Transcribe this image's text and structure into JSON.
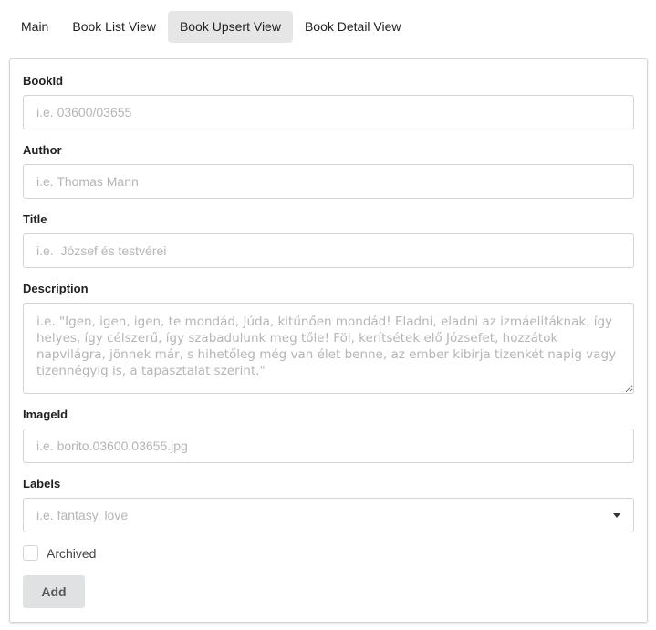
{
  "tabs": [
    {
      "label": "Main"
    },
    {
      "label": "Book List View"
    },
    {
      "label": "Book Upsert View"
    },
    {
      "label": "Book Detail View"
    }
  ],
  "active_tab": "Book Upsert View",
  "form": {
    "book_id": {
      "label": "BookId",
      "value": "",
      "placeholder": "i.e. 03600/03655"
    },
    "author": {
      "label": "Author",
      "value": "",
      "placeholder": "i.e. Thomas Mann"
    },
    "title": {
      "label": "Title",
      "value": "",
      "placeholder": "i.e.  József és testvérei"
    },
    "description": {
      "label": "Description",
      "value": "",
      "placeholder": "i.e. \"Igen, igen, igen, te mondád, Júda, kitűnően mondád! Eladni, eladni az izmáelitáknak, így helyes, így célszerű, így szabadulunk meg tőle! Föl, kerítsétek elő Józsefet, hozzátok napvilágra, jönnek már, s hihetőleg még van élet benne, az ember kibírja tizenkét napig vagy tizennégyig is, a tapasztalat szerint.\""
    },
    "image_id": {
      "label": "ImageId",
      "value": "",
      "placeholder": "i.e. borito.03600.03655.jpg"
    },
    "labels": {
      "label": "Labels",
      "selected": "",
      "placeholder": "i.e. fantasy, love"
    },
    "archived": {
      "label": "Archived",
      "checked": false
    },
    "submit_label": "Add"
  },
  "icons": {
    "labels_dropdown": "caret-down-icon"
  },
  "colors": {
    "active_tab_bg": "#e6e6e6",
    "button_bg": "#e0e1e2",
    "border": "#d4d4d5",
    "placeholder": "#b5b5b5"
  }
}
